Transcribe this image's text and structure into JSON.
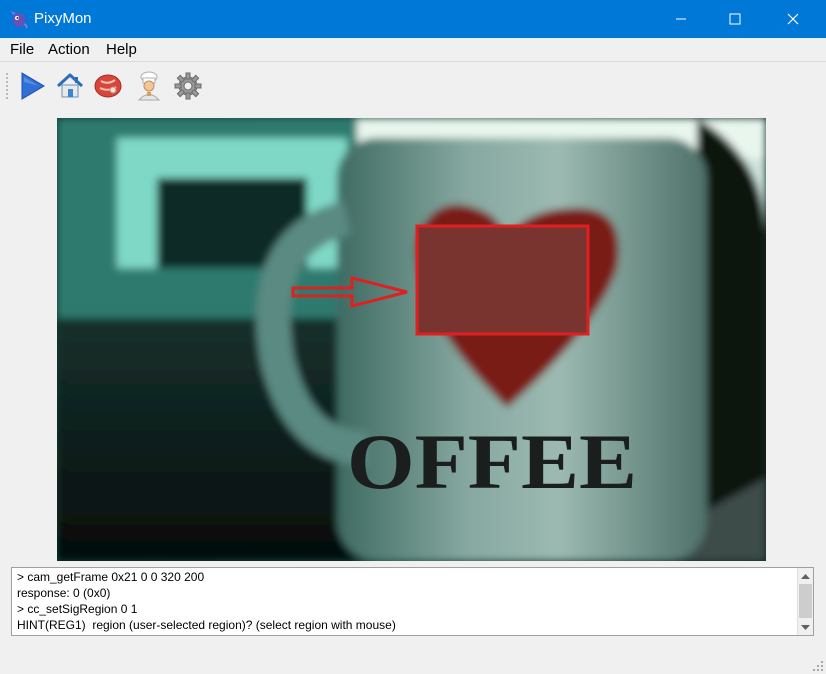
{
  "window": {
    "title": "PixyMon",
    "accent_color": "#0078d7",
    "controls": {
      "minimize_icon": "minimize-icon",
      "maximize_icon": "maximize-icon",
      "close_icon": "close-icon"
    }
  },
  "menu": {
    "items": [
      {
        "label": "File"
      },
      {
        "label": "Action"
      },
      {
        "label": "Help"
      }
    ]
  },
  "toolbar": {
    "buttons": [
      {
        "name": "run",
        "icon": "play-icon",
        "color": "#2f6fd6"
      },
      {
        "name": "default-program",
        "icon": "home-icon",
        "color": "#3a86d0"
      },
      {
        "name": "raw-video",
        "icon": "meat-icon",
        "color": "#d8453a"
      },
      {
        "name": "cooked-video",
        "icon": "chef-icon",
        "color": "#d9a05b"
      },
      {
        "name": "configure",
        "icon": "gear-icon",
        "color": "#8a8a8a"
      }
    ]
  },
  "video": {
    "content": "camera-frame",
    "selection_color": "#e02020",
    "cup_text": "OFFEE"
  },
  "console": {
    "lines": [
      "> cam_getFrame 0x21 0 0 320 200",
      "response: 0 (0x0)",
      "> cc_setSigRegion 0 1",
      "HINT(REG1)  region (user-selected region)? (select region with mouse)"
    ]
  }
}
